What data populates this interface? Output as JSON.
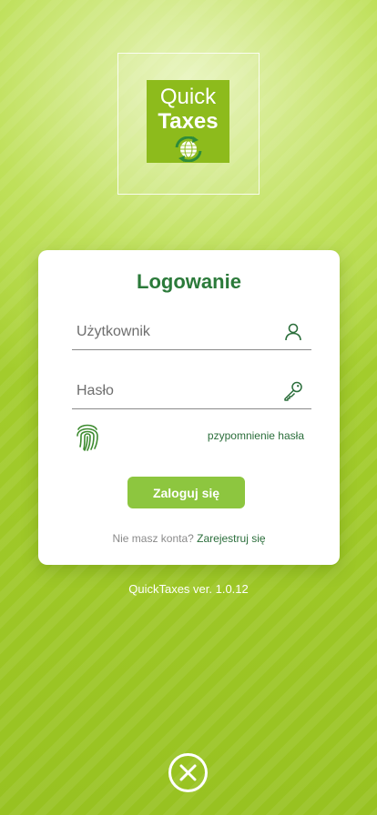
{
  "logo": {
    "line1": "Quick",
    "line2": "Taxes",
    "icon": "globe-recycle-icon"
  },
  "login_card": {
    "title": "Logowanie",
    "username": {
      "placeholder": "Użytkownik",
      "value": "",
      "icon": "user-icon"
    },
    "password": {
      "placeholder": "Hasło",
      "value": "",
      "icon": "key-icon"
    },
    "biometric_icon": "fingerprint-icon",
    "forgot_password_label": "pzypomnienie hasła",
    "submit_label": "Zaloguj się",
    "register_prompt": "Nie masz konta?",
    "register_link_label": "Zarejestruj się"
  },
  "version_text": "QuickTaxes ver. 1.0.12",
  "close_icon": "close-icon",
  "colors": {
    "background": "#a3cc2c",
    "logo_tile": "#8dbb1c",
    "title_green": "#2b7a3a",
    "button": "#8dc63f",
    "link": "#2b6e3b"
  }
}
